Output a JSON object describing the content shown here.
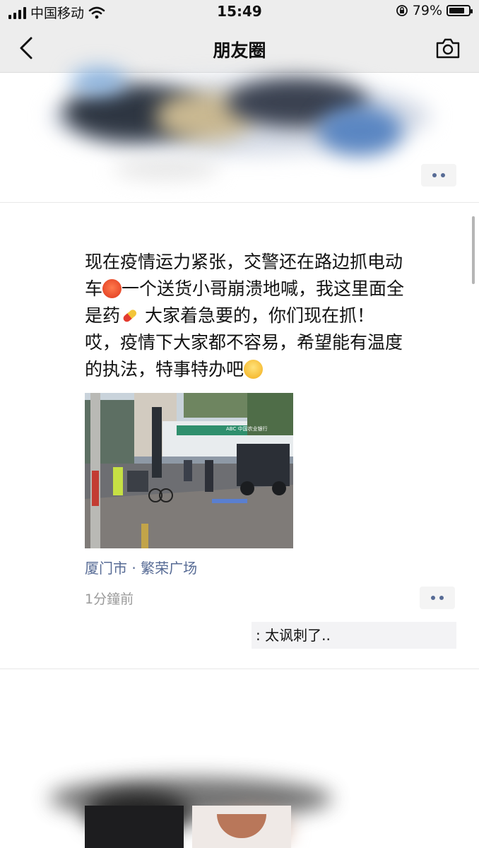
{
  "status_bar": {
    "carrier": "中国移动",
    "time": "15:49",
    "battery": "79%",
    "battery_level": 0.79
  },
  "nav": {
    "title": "朋友圈",
    "back_icon": "chevron-left-icon",
    "camera_icon": "camera-icon"
  },
  "post": {
    "text_lines": [
      "现在疫情运力紧张，交警还在路边抓电动",
      "一个送货小哥崩溃地喊，我这里面全",
      "大家着急要的，你们现在抓！",
      "哎，疫情下大家都不容易，希望能有温度",
      "的执法，特事特办吧"
    ],
    "line2_prefix": "车",
    "line3_prefix": "是药",
    "location": "厦门市 · 繁荣广场",
    "time_ago": "1分鐘前",
    "comment": ": 太讽刺了.."
  },
  "photo_signs": {
    "bank_sign": "ABC 中国农业银行"
  },
  "colors": {
    "link": "#576b95",
    "header_bg": "#ededed",
    "comment_bg": "#f3f3f5"
  }
}
